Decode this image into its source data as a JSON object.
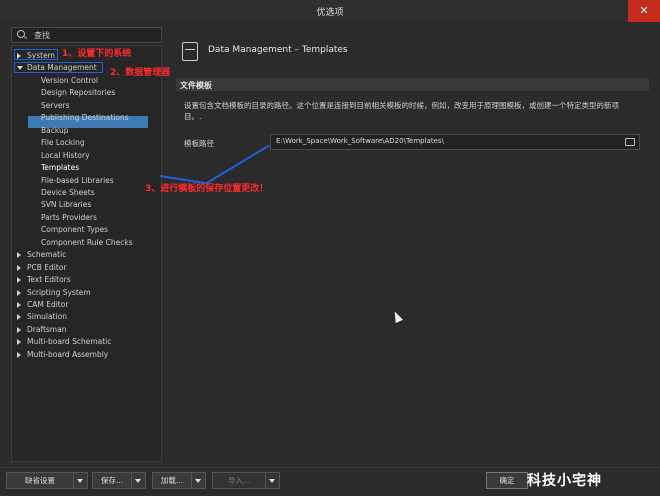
{
  "window": {
    "title": "优选项",
    "close": "✕"
  },
  "search": {
    "placeholder": "查找"
  },
  "tree": {
    "items": [
      {
        "label": "System",
        "expanded": false,
        "level": 0
      },
      {
        "label": "Data Management",
        "expanded": true,
        "level": 0
      },
      {
        "label": "Version Control",
        "level": 1
      },
      {
        "label": "Design Repositories",
        "level": 1
      },
      {
        "label": "Servers",
        "level": 1
      },
      {
        "label": "Publishing Destinations",
        "level": 1
      },
      {
        "label": "Backup",
        "level": 1
      },
      {
        "label": "File Locking",
        "level": 1
      },
      {
        "label": "Local History",
        "level": 1
      },
      {
        "label": "Templates",
        "level": 1,
        "selected": true
      },
      {
        "label": "File-based Libraries",
        "level": 1
      },
      {
        "label": "Device Sheets",
        "level": 1
      },
      {
        "label": "SVN Libraries",
        "level": 1
      },
      {
        "label": "Parts Providers",
        "level": 1
      },
      {
        "label": "Component Types",
        "level": 1
      },
      {
        "label": "Component Rule Checks",
        "level": 1
      },
      {
        "label": "Schematic",
        "expanded": false,
        "level": 0
      },
      {
        "label": "PCB Editor",
        "expanded": false,
        "level": 0
      },
      {
        "label": "Text Editors",
        "expanded": false,
        "level": 0
      },
      {
        "label": "Scripting System",
        "expanded": false,
        "level": 0
      },
      {
        "label": "CAM Editor",
        "expanded": false,
        "level": 0
      },
      {
        "label": "Simulation",
        "expanded": false,
        "level": 0
      },
      {
        "label": "Draftsman",
        "expanded": false,
        "level": 0
      },
      {
        "label": "Multi-board Schematic",
        "expanded": false,
        "level": 0
      },
      {
        "label": "Multi-board Assembly",
        "expanded": false,
        "level": 0
      }
    ]
  },
  "annotations": {
    "a1": "1、设置下的系统",
    "a2": "2、数据管理器",
    "a3": "3、进行模板的保存位置更改！"
  },
  "panel": {
    "title": "Data Management – Templates",
    "section": "文件模板",
    "description": "设置包含文档模板的目录的路径。这个位置是连接到目前相关模板的时候，例如，改变用于原理图模板，或创建一个特定类型的新项目。.",
    "path_label": "模板路径",
    "path_value": "E:\\Work_Space\\Work_Software\\AD20\\Templates\\"
  },
  "buttons": {
    "defaults": "缺省设置",
    "save": "保存...",
    "load": "加载...",
    "import": "导入...",
    "ok": "确定"
  },
  "watermark": "科技小宅神",
  "colors": {
    "annotation": "#ff2b2b",
    "selection": "#3d7ab3",
    "close": "#c42b1c",
    "marker": "#2060d8"
  }
}
